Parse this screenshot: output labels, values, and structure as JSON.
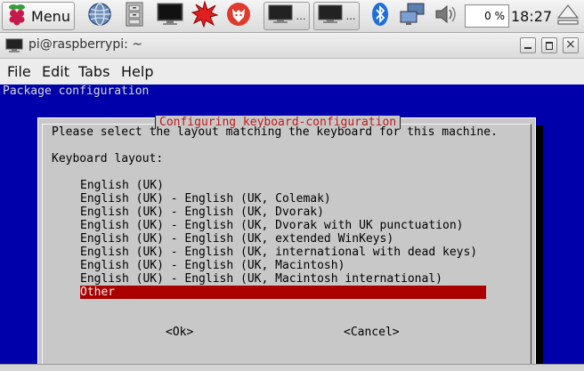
{
  "panel": {
    "menu_label": "Menu",
    "cpu_usage": "0 %",
    "clock": "18:27"
  },
  "window": {
    "title": "pi@raspberrypi: ~",
    "menus": [
      "File",
      "Edit",
      "Tabs",
      "Help"
    ]
  },
  "terminal": {
    "header": "Package configuration",
    "dialog": {
      "title": "Configuring keyboard-configuration",
      "prompt": "Please select the layout matching the keyboard for this machine.",
      "field_label": "Keyboard layout:",
      "options": [
        "English (UK)",
        "English (UK) - English (UK, Colemak)",
        "English (UK) - English (UK, Dvorak)",
        "English (UK) - English (UK, Dvorak with UK punctuation)",
        "English (UK) - English (UK, extended WinKeys)",
        "English (UK) - English (UK, international with dead keys)",
        "English (UK) - English (UK, Macintosh)",
        "English (UK) - English (UK, Macintosh international)",
        "Other"
      ],
      "selected_option": "Other",
      "ok_label": "<Ok>",
      "cancel_label": "<Cancel>"
    }
  },
  "colors": {
    "terminal_bg": "#0000aa",
    "dialog_bg": "#c8c8c8",
    "selection_bg": "#aa0000",
    "dialog_title": "#c41a1a"
  }
}
